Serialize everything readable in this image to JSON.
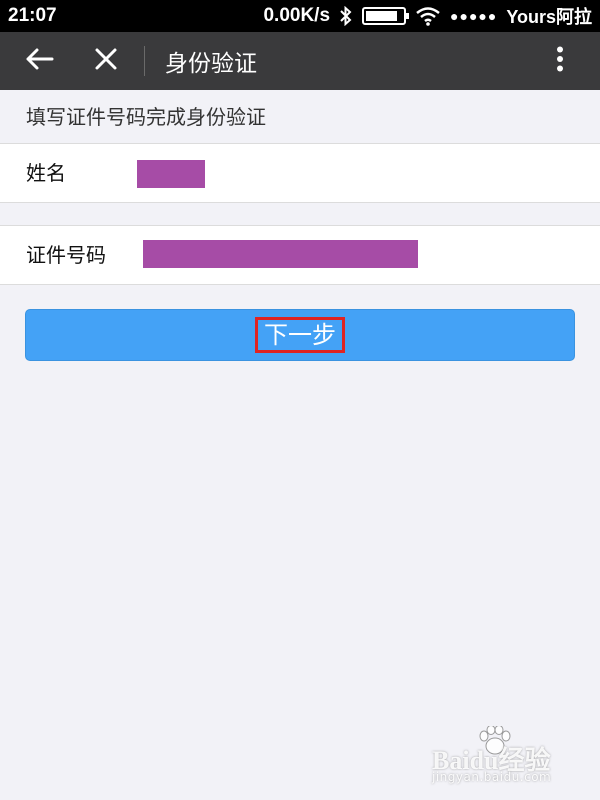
{
  "status_bar": {
    "time": "21:07",
    "network_speed": "0.00K/s",
    "signal_dots": "●●●●●",
    "carrier": "Yours阿拉",
    "battery_level": 0.85
  },
  "title_bar": {
    "back_icon": "arrow-left-icon",
    "close_icon": "close-icon",
    "title": "身份验证",
    "more_icon": "more-vertical-icon"
  },
  "form": {
    "instruction": "填写证件号码完成身份验证",
    "name_label": "姓名",
    "id_label": "证件号码",
    "redaction_color": "#a64ca6"
  },
  "next_button": {
    "label": "下一步",
    "color": "#44a2f6",
    "highlight_color": "#e02424"
  },
  "watermark": {
    "brand": "Baidu经验",
    "url": "jingyan.baidu.com"
  }
}
